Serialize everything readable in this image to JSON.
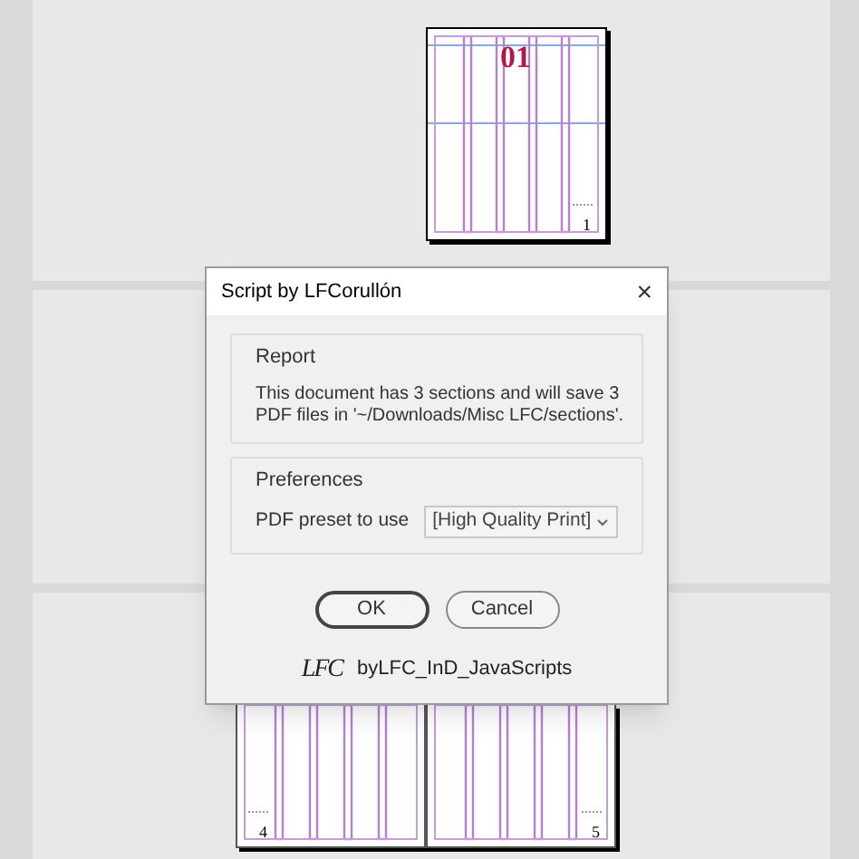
{
  "pages": [
    {
      "kind": "single",
      "labels": [
        "01",
        "1"
      ]
    },
    {
      "kind": "spread",
      "labels": [
        "4",
        "5"
      ]
    }
  ],
  "dialog": {
    "title": "Script by LFCorullón",
    "close": "×",
    "report": {
      "title": "Report",
      "message": "This document has 3 sections and will save 3 PDF files in '~/Downloads/Misc LFC/sections'."
    },
    "preferences": {
      "title": "Preferences",
      "label": "PDF preset to use",
      "value": "[High Quality Print]"
    },
    "buttons": [
      {
        "label": "OK",
        "default": true
      },
      {
        "label": "Cancel",
        "default": false
      }
    ],
    "footer": {
      "logo": "LFC",
      "text": "byLFC_InD_JavaScripts"
    }
  }
}
